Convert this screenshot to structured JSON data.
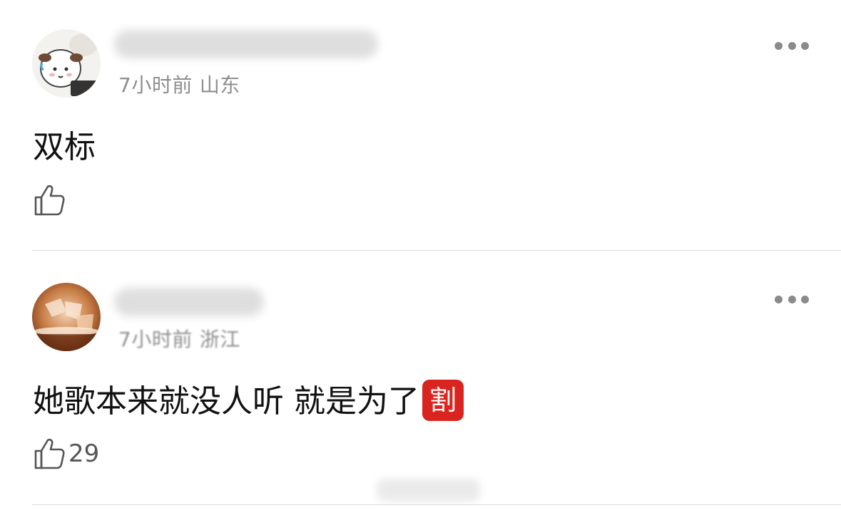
{
  "comments": [
    {
      "time": "7小时前",
      "location": "山东",
      "text": "双标",
      "like_count": ""
    },
    {
      "time": "7小时前",
      "location": "浙江",
      "text": "她歌本来就没人听 就是为了",
      "emoji": "割",
      "like_count": "29"
    }
  ],
  "colors": {
    "meta": "#8e8e8e",
    "emoji_bg": "#d9241f",
    "divider": "#dcdcdc"
  },
  "icons": [
    "more-dots-icon",
    "thumbs-up-icon"
  ]
}
